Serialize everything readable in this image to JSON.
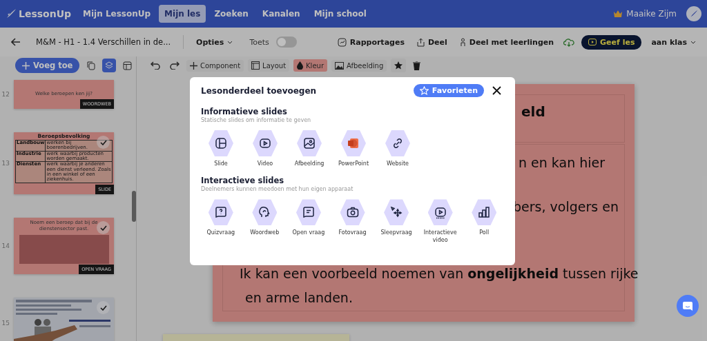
{
  "header": {
    "logo": "LessonUp",
    "nav": [
      {
        "label": "Mijn LessonUp",
        "selected": false
      },
      {
        "label": "Mijn les",
        "selected": true
      },
      {
        "label": "Zoeken",
        "selected": false
      },
      {
        "label": "Kanalen",
        "selected": false
      },
      {
        "label": "Mijn school",
        "selected": false
      }
    ],
    "user": "Maaike Zijm"
  },
  "toolbar": {
    "title": "M&M - H1 - 1.4 Verschillen in de...",
    "options": "Opties",
    "test": {
      "label": "Toets",
      "on": false
    },
    "actions": [
      "Rapportages",
      "Deel",
      "Deel met leerlingen"
    ],
    "teach": "Geef les",
    "audience": "aan klas"
  },
  "edit_toolbar": {
    "add": "Voeg toe",
    "tools": [
      "Component",
      "Layout",
      "Kleur",
      "Afbeelding"
    ]
  },
  "slides": [
    {
      "number": "12",
      "title": "Welke beroepen ken jij?",
      "kind": "wordweb",
      "tag": "WOORDWEB",
      "checked": false
    },
    {
      "number": "13",
      "title": "Beroepsbevolking",
      "kind": "table",
      "tag": "SLIDE",
      "checked": true,
      "rows": [
        [
          "Landbouw",
          "werken bij boerenbedrijven."
        ],
        [
          "Industrie",
          "werk waarbij producten worden gemaakt."
        ],
        [
          "Diensten",
          "werk waarbij je anderen een dienst verleend. Zoals in een winkel of een ziekenhuis."
        ]
      ]
    },
    {
      "number": "14",
      "title": "Noem een beroep dat bij de dienstensector past.",
      "kind": "open",
      "tag": "OPEN VRAAG",
      "checked": true
    },
    {
      "number": "15",
      "kind": "picture",
      "checked": true
    }
  ],
  "canvas": {
    "title": "eld",
    "lines": [
      "n en kan hier",
      "bers, volgers en"
    ],
    "bullet": "Ik kan een voorbeeld noemen van **ongelijkheid** tussen rijke",
    "bullet_cont": "en arme landen."
  },
  "dialog": {
    "title": "Lesonderdeel toevoegen",
    "favorites": "Favorieten",
    "sections": [
      {
        "title": "Informatieve slides",
        "subtitle": "Statische slides om informatie te geven",
        "items": [
          "Slide",
          "Video",
          "Afbeelding",
          "PowerPoint",
          "Website"
        ]
      },
      {
        "title": "Interactieve slides",
        "subtitle": "Deelnemers kunnen meedoen met hun eigen apparaat",
        "items": [
          "Quizvraag",
          "Woordweb",
          "Open vraag",
          "Fotovraag",
          "Sleepvraag",
          "Interactieve video",
          "Poll"
        ]
      }
    ]
  }
}
